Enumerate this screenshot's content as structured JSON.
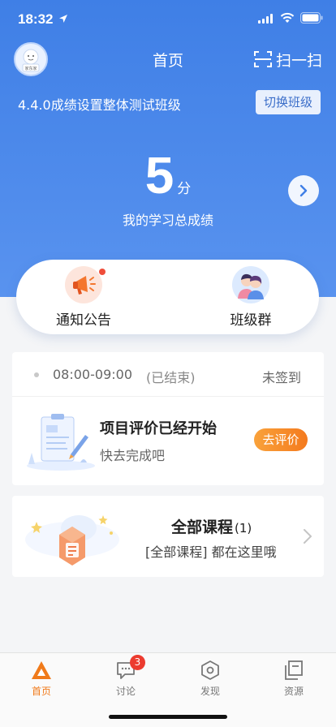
{
  "status_bar": {
    "time": "18:32"
  },
  "header": {
    "avatar_text": "家东家",
    "title": "首页",
    "scan_label": "扫一扫"
  },
  "class_info": {
    "name": "4.4.0成绩设置整体测试班级",
    "switch_label": "切换班级"
  },
  "score": {
    "value": "5",
    "unit": "分",
    "label": "我的学习总成绩"
  },
  "entries": [
    {
      "label": "通知公告",
      "icon": "megaphone-icon",
      "has_dot": true
    },
    {
      "label": "班级群",
      "icon": "group-chat-icon",
      "has_dot": false
    }
  ],
  "attendance": {
    "time_range": "08:00-09:00",
    "status": "(已结束)",
    "sign_state": "未签到"
  },
  "task": {
    "title": "项目评价已经开始",
    "subtitle": "快去完成吧",
    "action_label": "去评价"
  },
  "course": {
    "title": "全部课程",
    "count": "(1)",
    "subtitle": "[全部课程] 都在这里哦"
  },
  "tabs": [
    {
      "label": "首页",
      "icon": "home-icon",
      "active": true
    },
    {
      "label": "讨论",
      "icon": "chat-icon",
      "badge": "3"
    },
    {
      "label": "发现",
      "icon": "discover-icon"
    },
    {
      "label": "资源",
      "icon": "resources-icon"
    }
  ],
  "colors": {
    "primary": "#3f7fe6",
    "accent": "#f47a1e",
    "badge": "#ec3b2f"
  }
}
